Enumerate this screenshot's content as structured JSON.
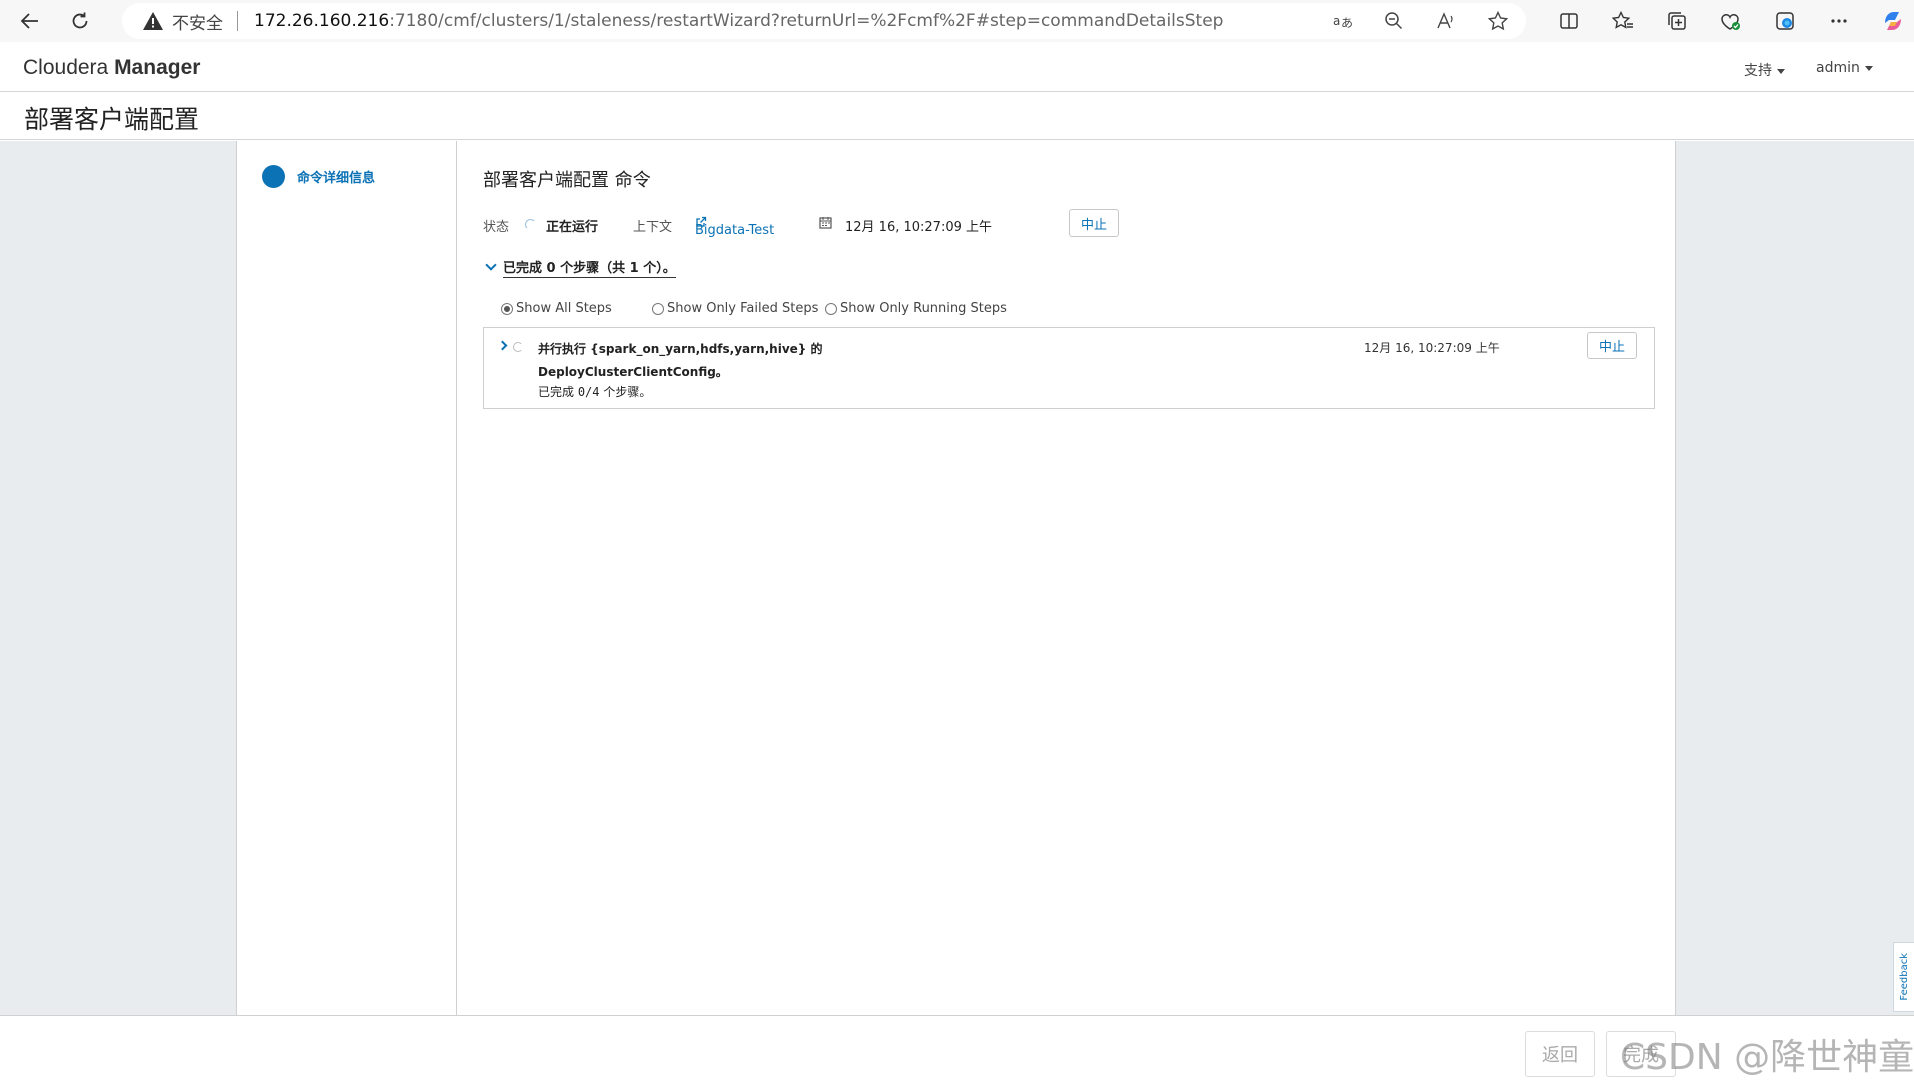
{
  "browser": {
    "insecure_label": "不安全",
    "url_host": "172.26.160.216",
    "url_rest": ":7180/cmf/clusters/1/staleness/restartWizard?returnUrl=%2Fcmf%2F#step=commandDetailsStep"
  },
  "header": {
    "brand_light": "Cloudera ",
    "brand_bold": "Manager",
    "support_label": "支持",
    "user_label": "admin"
  },
  "page": {
    "title": "部署客户端配置"
  },
  "wizard_nav": {
    "steps": [
      {
        "label": "命令详细信息"
      }
    ]
  },
  "command": {
    "title": "部署客户端配置 命令",
    "status_label": "状态",
    "status_value": "正在运行",
    "context_label": "上下文",
    "context_link": "Bigdata-Test",
    "timestamp": "12月 16, 10:27:09 上午",
    "abort_label": "中止",
    "summary": "已完成 0 个步骤（共 1 个）。"
  },
  "filters": {
    "options": [
      "Show All Steps",
      "Show Only Failed Steps",
      "Show Only Running Steps"
    ],
    "selected": "Show All Steps"
  },
  "steps": [
    {
      "desc_line1": "并行执行 {spark_on_yarn,hdfs,yarn,hive} 的",
      "desc_line2": "DeployClusterClientConfig。",
      "progress_prefix": "已完成 ",
      "progress_count": "0/4",
      "progress_suffix": " 个步骤。",
      "time": "12月 16, 10:27:09 上午",
      "abort_label": "中止"
    }
  ],
  "footer": {
    "back_label": "返回",
    "finish_label": "完成"
  },
  "watermark": "CSDN @降世神童",
  "feedback_label": "Feedback"
}
